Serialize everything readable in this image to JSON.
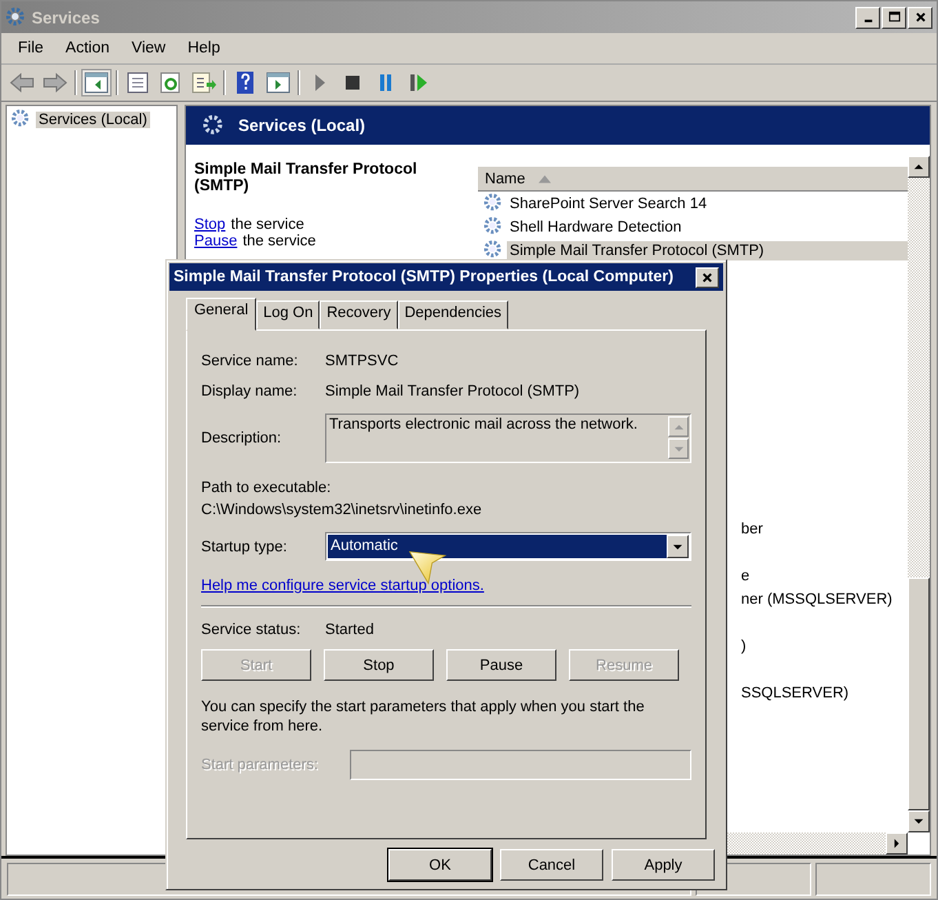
{
  "window": {
    "title": "Services"
  },
  "menu": [
    "File",
    "Action",
    "View",
    "Help"
  ],
  "tree": [
    {
      "label": "Services (Local)",
      "selected": true
    }
  ],
  "header": {
    "title": "Services (Local)"
  },
  "details": {
    "title": "Simple Mail Transfer Protocol (SMTP)",
    "actions": [
      {
        "link": "Stop",
        "text": "the service"
      },
      {
        "link": "Pause",
        "text": "the service"
      }
    ]
  },
  "list": {
    "columns": [
      "Name"
    ],
    "rows": [
      {
        "name": "SharePoint Server Search 14",
        "selected": false
      },
      {
        "name": "Shell Hardware Detection",
        "selected": false
      },
      {
        "name": "Simple Mail Transfer Protocol (SMTP)",
        "selected": true
      }
    ],
    "rows_partly_hidden": [
      "ber",
      "e",
      "ner (MSSQLSERVER)",
      ")",
      "SSQLSERVER)"
    ]
  },
  "dialog": {
    "title": "Simple Mail Transfer Protocol (SMTP) Properties (Local Computer)",
    "tabs": [
      {
        "label": "General",
        "selected": true
      },
      {
        "label": "Log On",
        "selected": false
      },
      {
        "label": "Recovery",
        "selected": false
      },
      {
        "label": "Dependencies",
        "selected": false
      }
    ],
    "service_name": {
      "label": "Service name:",
      "value": "SMTPSVC"
    },
    "display_name": {
      "label": "Display name:",
      "value": "Simple Mail Transfer Protocol (SMTP)"
    },
    "description": {
      "label": "Description:",
      "value": "Transports electronic mail across the network."
    },
    "path": {
      "label": "Path to executable:",
      "value": "C:\\Windows\\system32\\inetsrv\\inetinfo.exe"
    },
    "startup_type": {
      "label": "Startup type:",
      "value": "Automatic"
    },
    "help_link": "Help me configure service startup options.",
    "service_status": {
      "label": "Service status:",
      "value": "Started"
    },
    "control_buttons": [
      {
        "label": "Start",
        "disabled": true
      },
      {
        "label": "Stop",
        "disabled": false
      },
      {
        "label": "Pause",
        "disabled": false
      },
      {
        "label": "Resume",
        "disabled": true
      }
    ],
    "params_note": "You can specify the start parameters that apply when you start the service from here.",
    "start_parameters": {
      "label": "Start parameters:",
      "disabled": true
    },
    "footer_buttons": [
      {
        "label": "OK",
        "default": true
      },
      {
        "label": "Cancel",
        "default": false
      },
      {
        "label": "Apply",
        "default": false
      }
    ]
  }
}
